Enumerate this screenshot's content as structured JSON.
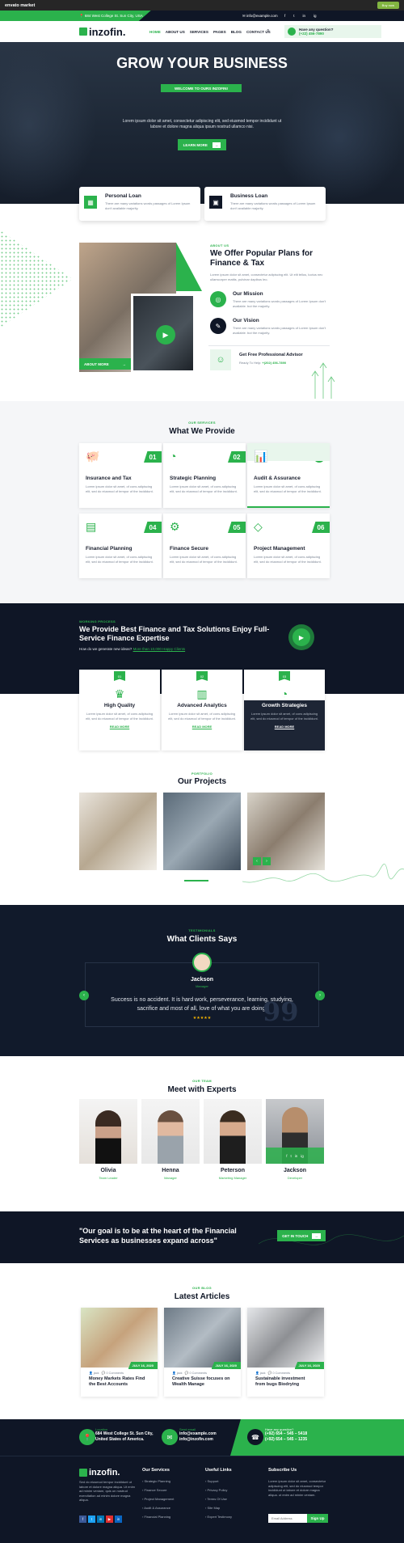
{
  "envato": {
    "logo": "envato market",
    "buy": "Buy now"
  },
  "topbar": {
    "address": "684 West College St. Sun City, USA",
    "email": "info@example.com",
    "social": [
      "f",
      "t",
      "in",
      "ig"
    ]
  },
  "header": {
    "logo": "inzofin.",
    "nav": [
      "HOME",
      "ABOUT US",
      "SERVICES",
      "PAGES",
      "BLOG",
      "CONTACT US"
    ],
    "question": "Have any question?",
    "phone": "(+22) 456-7890"
  },
  "hero": {
    "pill": "WELCOME TO OURS INZOFIN!",
    "title": "GROW YOUR BUSINESS",
    "text": "Lorem ipsum dolor sit amet, consectetur adipiscing elit, sed eiusmod tempor incididunt ut labore et dolore magna aliqua ipsum nostrud ullamco nisi.",
    "button": "LEARN MORE"
  },
  "loans": [
    {
      "title": "Personal Loan",
      "text": "There are many variations words passages of Lorem Ipsum don't available majority."
    },
    {
      "title": "Business Loan",
      "text": "There are many variations words passages of Lorem Ipsum don't available majority."
    }
  ],
  "about": {
    "label": "ABOUT US",
    "title": "We Offer Popular Plans for Finance & Tax",
    "text": "Lorem ipsum dolor sit amet, consectetur adipiscing elit. Ut elit tellus, luctus nec ullamcorper mattis, pulvinar dapibus leo.",
    "mission_title": "Our Mission",
    "mission_text": "There are many variations words passages of Lorem Ipsum don't available. but the majority.",
    "vision_title": "Our Vision",
    "vision_text": "There are many variations words passages of Lorem Ipsum don't available. but the majority.",
    "advisor_title": "Get Free Professional Advisor",
    "advisor_ready": "Ready To Help: ",
    "advisor_phone": "+(202) 456-7890",
    "button": "ABOUT MORE"
  },
  "services": {
    "label": "OUR SERVICES",
    "title": "What We Provide",
    "items": [
      {
        "num": "01",
        "title": "Insurance and Tax",
        "text": "Lorem ipsum dolor sit amet, of cons adipiscing elit, sed do eiusmod of tempor of the incididunt.",
        "icon": "piggy-icon"
      },
      {
        "num": "02",
        "title": "Strategic Planning",
        "text": "Lorem ipsum dolor sit amet, of cons adipiscing elit, sed do eiusmod of tempor of the incididunt.",
        "icon": "pie-icon"
      },
      {
        "num": "+",
        "title": "Audit & Assurance",
        "text": "Lorem ipsum dolor sit amet, of cons adipiscing elit, sed do eiusmod of tempor of the incididunt.",
        "icon": "chart-icon"
      },
      {
        "num": "04",
        "title": "Financial Planning",
        "text": "Lorem ipsum dolor sit amet, of cons adipiscing elit, sed do eiusmod of tempor of the incididunt.",
        "icon": "doc-icon"
      },
      {
        "num": "05",
        "title": "Finance Secure",
        "text": "Lorem ipsum dolor sit amet, of cons adipiscing elit, sed do eiusmod of tempor of the incididunt.",
        "icon": "gear-icon"
      },
      {
        "num": "06",
        "title": "Project Management",
        "text": "Lorem ipsum dolor sit amet, of cons adipiscing elit, sed do eiusmod of tempor of the incididunt.",
        "icon": "diamond-icon"
      }
    ]
  },
  "process": {
    "label": "WORKING PROCESS",
    "title": "We Provide Best Finance and Tax Solutions Enjoy Full-Service Finance Expertise",
    "question": "How do we generate new ideas?",
    "link": "More than 10,000 Happy Clients",
    "items": [
      {
        "num": "01",
        "title": "High Quality",
        "text": "Lorem ipsum dolor sit amet, of cons adipiscing elit, sed do eiusmod of tempor of the incididunt.",
        "more": "READ MORE"
      },
      {
        "num": "02",
        "title": "Advanced Analytics",
        "text": "Lorem ipsum dolor sit amet, of cons adipiscing elit, sed do eiusmod of tempor of the incididunt.",
        "more": "READ MORE"
      },
      {
        "num": "03",
        "title": "Growth Strategies",
        "text": "Lorem ipsum dolor sit amet, of cons adipiscing elit, sed do eiusmod of tempor of the incididunt.",
        "more": "READ MORE"
      }
    ]
  },
  "projects": {
    "label": "PORTFOLIO",
    "title": "Our Projects"
  },
  "testimonial": {
    "label": "TESTIMONIALS",
    "title": "What Clients Says",
    "name": "Jackson",
    "role": "Manager",
    "quote": "Success is no accident. It is hard work, perseverance, learning, studying, sacrifice and most of all, love of what you are doing.",
    "stars": "★★★★★"
  },
  "team": {
    "label": "OUR TEAM",
    "title": "Meet with Experts",
    "members": [
      {
        "name": "Olivia",
        "role": "Team Leader"
      },
      {
        "name": "Henna",
        "role": "Manager"
      },
      {
        "name": "Peterson",
        "role": "Marketing Manager"
      },
      {
        "name": "Jackson",
        "role": "Developer"
      }
    ]
  },
  "banner": {
    "quote": "\"Our goal is to be at the heart of the Financial Services as businesses expand across\"",
    "button": "GET IN TOUCH"
  },
  "blog": {
    "label": "OUR BLOG",
    "title": "Latest Articles",
    "items": [
      {
        "date": "JULY 16, 2020",
        "author": "jack",
        "comments": "0 Comments",
        "title": "Money Markets Rates Find the Best Accounts"
      },
      {
        "date": "JULY 16, 2020",
        "author": "jack",
        "comments": "0 Comments",
        "title": "Creative Suisse focuses on Wealth Manage"
      },
      {
        "date": "JULY 16, 2020",
        "author": "jack",
        "comments": "0 Comments",
        "title": "Sustainable investment from bugs Biodrying"
      }
    ]
  },
  "footer_top": {
    "loc_label": "Location",
    "loc": "684 West College St. Sun City, United States of America.",
    "mail_label": "Send email",
    "mail1": "info@example.com",
    "mail2": "info@inzofin.com",
    "q_label": "Have any question?",
    "phone1": "(+92) 654 – 545 – 5418",
    "phone2": "(+92) 654 – 545 – 1235"
  },
  "footer": {
    "logo": "inzofin.",
    "about": "Sed do eiusmod tempor incididunt ut labore et dolore magna aliqua. Ut enim ad minim veniam, quis un nostrud exercitation ad minim dolore magna aliqua.",
    "services_title": "Our Services",
    "services": [
      "Strategic Planning",
      "Finance Secure",
      "Project Management",
      "Audit & Assurance",
      "Financial Planning"
    ],
    "links_title": "Useful Links",
    "links": [
      "Support",
      "Privacy Policy",
      "Terms Of Use",
      "Site Map",
      "Expert Testimony"
    ],
    "sub_title": "Subscribe Us",
    "sub_text": "Lorem ipsum dolor sit amet, consectetur adipiscing elit, sed do eiusmod tempor incididunt ut labore et dolore magna aliqua. ut enim ad minim veniam.",
    "sub_placeholder": "Email Address",
    "sub_button": "Sign Up",
    "social": [
      "f",
      "t",
      "in",
      "▶",
      "in"
    ]
  }
}
